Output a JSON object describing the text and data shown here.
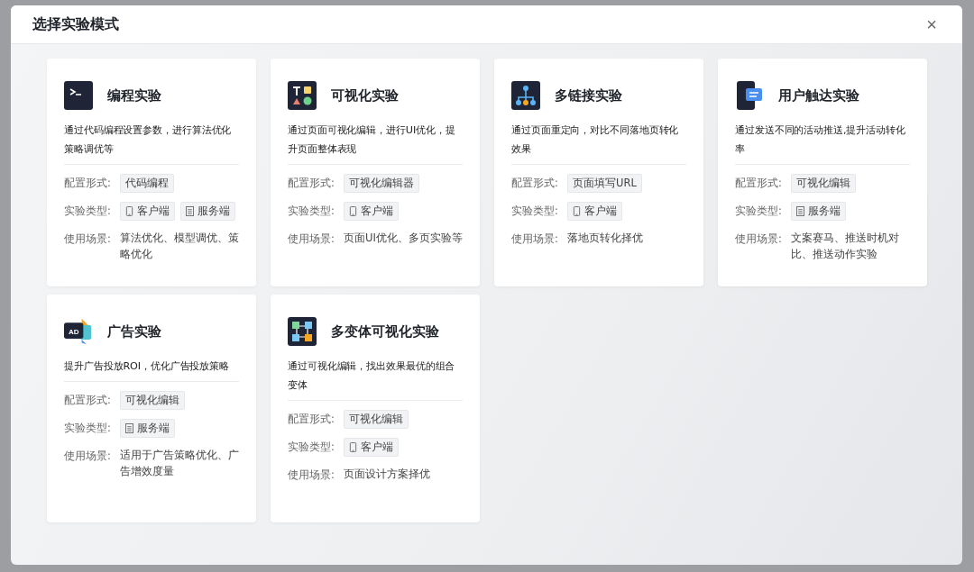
{
  "dialog": {
    "title": "选择实验模式",
    "close": "×"
  },
  "cards": [
    {
      "kind": "terminal",
      "title": "编程实验",
      "description": "通过代码编程设置参数，进行算法优化策略调优等",
      "config_label": "配置形式:",
      "config": "代码编程",
      "type_label": "实验类型:",
      "types": [
        {
          "kind": "client",
          "label": "客户端"
        },
        {
          "kind": "server",
          "label": "服务端"
        }
      ],
      "scene_label": "使用场景:",
      "scene": "算法优化、模型调优、策略优化"
    },
    {
      "kind": "shapes",
      "title": "可视化实验",
      "description": "通过页面可视化编辑，进行UI优化，提升页面整体表现",
      "config_label": "配置形式:",
      "config": "可视化编辑器",
      "type_label": "实验类型:",
      "types": [
        {
          "kind": "client",
          "label": "客户端"
        }
      ],
      "scene_label": "使用场景:",
      "scene": "页面UI优化、多页实验等"
    },
    {
      "kind": "tree",
      "title": "多链接实验",
      "description": "通过页面重定向，对比不同落地页转化效果",
      "config_label": "配置形式:",
      "config": "页面填写URL",
      "type_label": "实验类型:",
      "types": [
        {
          "kind": "client",
          "label": "客户端"
        }
      ],
      "scene_label": "使用场景:",
      "scene": "落地页转化择优"
    },
    {
      "kind": "phone",
      "title": "用户触达实验",
      "description": "通过发送不同的活动推送,提升活动转化率",
      "config_label": "配置形式:",
      "config": "可视化编辑",
      "type_label": "实验类型:",
      "types": [
        {
          "kind": "server",
          "label": "服务端"
        }
      ],
      "scene_label": "使用场景:",
      "scene": "文案赛马、推送时机对比、推送动作实验"
    },
    {
      "kind": "ad",
      "icon_text": "AD",
      "title": "广告实验",
      "description": "提升广告投放ROI，优化广告投放策略",
      "config_label": "配置形式:",
      "config": "可视化编辑",
      "type_label": "实验类型:",
      "types": [
        {
          "kind": "server",
          "label": "服务端"
        }
      ],
      "scene_label": "使用场景:",
      "scene": "适用于广告策略优化、广告增效度量"
    },
    {
      "kind": "grid",
      "title": "多变体可视化实验",
      "description": "通过可视化编辑，找出效果最优的组合变体",
      "config_label": "配置形式:",
      "config": "可视化编辑",
      "type_label": "实验类型:",
      "types": [
        {
          "kind": "client",
          "label": "客户端"
        }
      ],
      "scene_label": "使用场景:",
      "scene": "页面设计方案择优"
    }
  ]
}
